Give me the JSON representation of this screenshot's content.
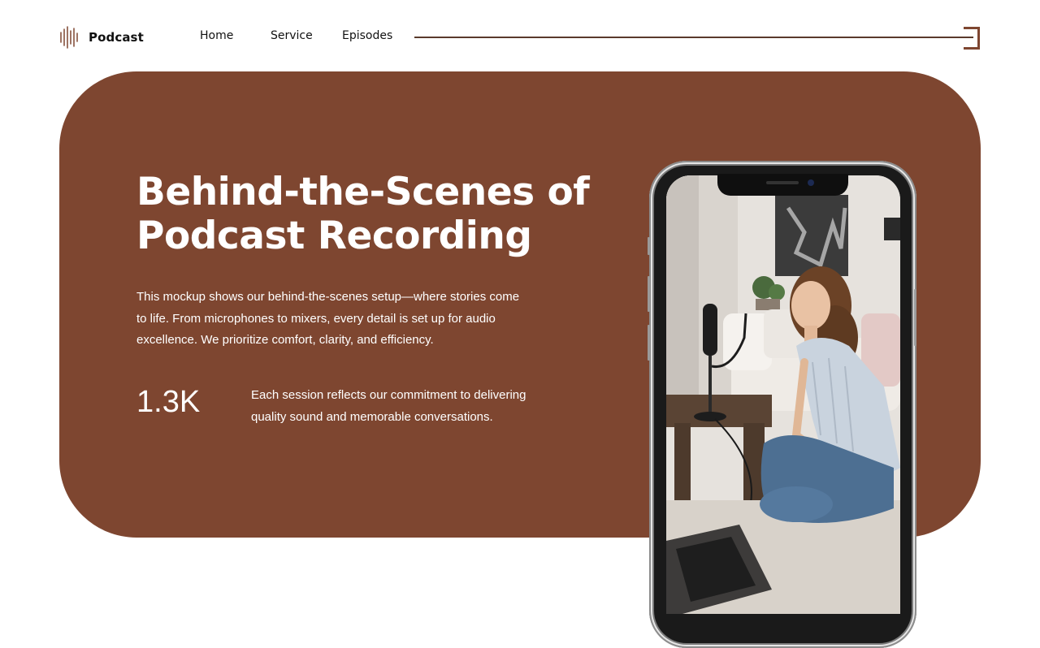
{
  "brand": {
    "name": "Podcast",
    "icon": "soundwave-icon",
    "color": "#7e4630"
  },
  "nav": {
    "home": "Home",
    "service": "Service",
    "episodes": "Episodes"
  },
  "menu": {
    "icon": "menu-bracket-icon"
  },
  "hero": {
    "background": "#7e4630",
    "title_line1": "Behind-the-Scenes of",
    "title_line2": "Podcast Recording",
    "description": "This mockup shows our behind-the-scenes setup—where stories come to life. From microphones to mixers, every detail is set up for audio excellence. We prioritize comfort, clarity, and efficiency.",
    "stat_value": "1.3K",
    "stat_description": "Each session reflects our commitment to delivering quality sound and memorable conversations."
  },
  "phone": {
    "screen_content": "photo-woman-recording-podcast"
  }
}
